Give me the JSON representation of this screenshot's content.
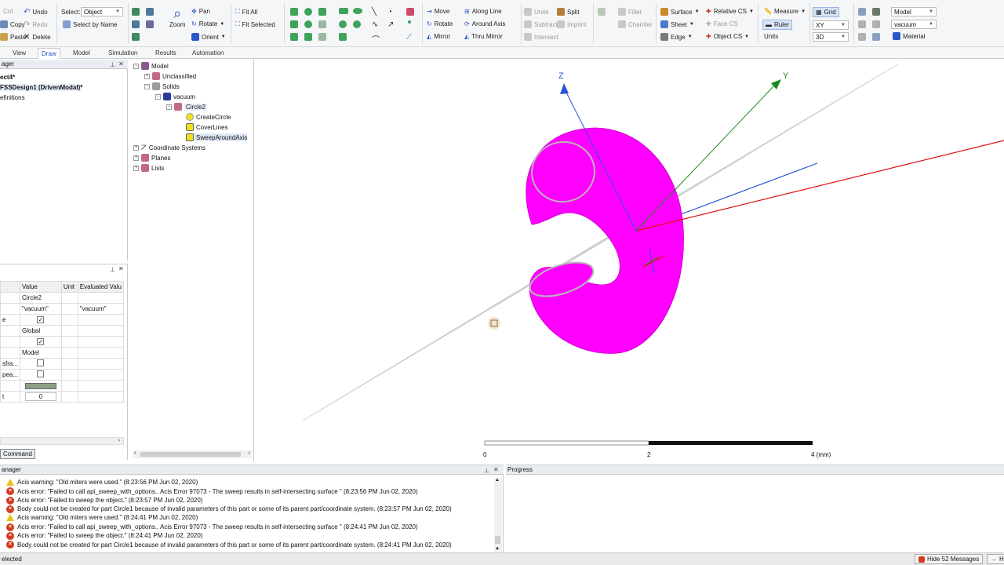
{
  "ribbon": {
    "edit": {
      "cut": "Cut",
      "copy": "Copy",
      "paste": "Paste",
      "undo": "Undo",
      "redo": "Redo",
      "delete": "Delete"
    },
    "select": {
      "label": "Select:",
      "value": "Object",
      "by_name": "Select by Name"
    },
    "zoom": {
      "label": "Zoom",
      "pan": "Pan",
      "rotate": "Rotate",
      "orient": "Orient"
    },
    "fit": {
      "all": "Fit All",
      "selected": "Fit Selected"
    },
    "transform": {
      "move": "Move",
      "rotate": "Rotate",
      "mirror": "Mirror"
    },
    "duplicate": {
      "along_line": "Along Line",
      "around_axis": "Around Axis",
      "thru_mirror": "Thru Mirror"
    },
    "boolean": {
      "unite": "Unite",
      "subtract": "Subtract",
      "intersect": "Intersect",
      "split": "Split",
      "imprint": "Imprint"
    },
    "modify": {
      "fillet": "Fillet",
      "chamfer": "Chamfer"
    },
    "cs": {
      "surface": "Surface",
      "sheet": "Sheet",
      "edge": "Edge",
      "relative": "Relative CS",
      "face": "Face CS",
      "object": "Object CS"
    },
    "measure": {
      "measure": "Measure",
      "ruler": "Ruler",
      "units": "Units"
    },
    "grid": {
      "grid": "Grid",
      "plane": "XY",
      "mode": "3D"
    },
    "material": {
      "model": "Model",
      "material_value": "vacuum",
      "material_label": "Material"
    }
  },
  "tabs": [
    "View",
    "Draw",
    "Model",
    "Simulation",
    "Results",
    "Automation"
  ],
  "project": {
    "header": "ager",
    "project_name": "ect4*",
    "design": "FSSDesign1 (DrivenModal)*",
    "definitions": "efinitions"
  },
  "tree": {
    "model": "Model",
    "unclassified": "Unclassified",
    "solids": "Solids",
    "vacuum": "vacuum",
    "circle2": "Circle2",
    "create_circle": "CreateCircle",
    "cover_lines": "CoverLines",
    "sweep": "SweepAroundAxis",
    "coord_systems": "Coordinate Systems",
    "planes": "Planes",
    "lists": "Lists"
  },
  "properties": {
    "headers": [
      "",
      "Value",
      "Unit",
      "Evaluated Valu"
    ],
    "rows": [
      {
        "name": "",
        "value": "Circle2",
        "eval": ""
      },
      {
        "name": "",
        "value": "\"vacuum\"",
        "eval": "\"vacuum\""
      },
      {
        "name": "e",
        "value": "",
        "eval": "",
        "check": true
      },
      {
        "name": "",
        "value": "Global",
        "eval": ""
      },
      {
        "name": "",
        "value": "",
        "eval": "",
        "check": true
      },
      {
        "name": "",
        "value": "Model",
        "eval": ""
      },
      {
        "name": "sfra...",
        "value": "",
        "eval": "",
        "check": false
      },
      {
        "name": "pea...",
        "value": "",
        "eval": "",
        "check": false
      },
      {
        "name": "",
        "value": "",
        "eval": "",
        "swatch": "#8fa08a"
      },
      {
        "name": "t",
        "value": "0",
        "eval": ""
      }
    ],
    "tab": "Command"
  },
  "viewport": {
    "axis_z": "Z",
    "axis_y": "Y",
    "scale": {
      "t0": "0",
      "t1": "2",
      "t2": "4 (mm)"
    }
  },
  "messages": {
    "header": "anager",
    "items": [
      {
        "type": "warn",
        "text": "Acis warning: \"Old miters were used.\" (8:23:56 PM  Jun 02, 2020)"
      },
      {
        "type": "err",
        "text": "Acis error: \"Failed to call api_sweep_with_options.. Acis Error 97073 - The sweep results in self-intersecting surface \" (8:23:56 PM  Jun 02, 2020)"
      },
      {
        "type": "err",
        "text": "Acis error: \"Failed to sweep the object.\" (8:23:57 PM  Jun 02, 2020)"
      },
      {
        "type": "err",
        "text": "Body could not be created for part Circle1 because of invalid parameters of this part or some of its parent part/coordinate system. (8:23:57 PM  Jun 02, 2020)"
      },
      {
        "type": "warn",
        "text": "Acis warning: \"Old miters were used.\" (8:24:41 PM  Jun 02, 2020)"
      },
      {
        "type": "err",
        "text": "Acis error: \"Failed to call api_sweep_with_options.. Acis Error 97073 - The sweep results in self-intersecting surface \" (8:24:41 PM  Jun 02, 2020)"
      },
      {
        "type": "err",
        "text": "Acis error: \"Failed to sweep the object.\" (8:24:41 PM  Jun 02, 2020)"
      },
      {
        "type": "err",
        "text": "Body could not be created for part Circle1 because of invalid parameters of this part or some of its parent part/coordinate system. (8:24:41 PM  Jun 02, 2020)"
      }
    ]
  },
  "progress": {
    "header": "Progress"
  },
  "status": {
    "left": "elected",
    "hide": "Hide 52 Messages",
    "right": "H"
  },
  "colors": {
    "torus": "#ff00ff",
    "axis_x": "#e01010",
    "axis_y": "#1a8a1a",
    "axis_z": "#2a50d8",
    "accent": "#2a56c6"
  }
}
